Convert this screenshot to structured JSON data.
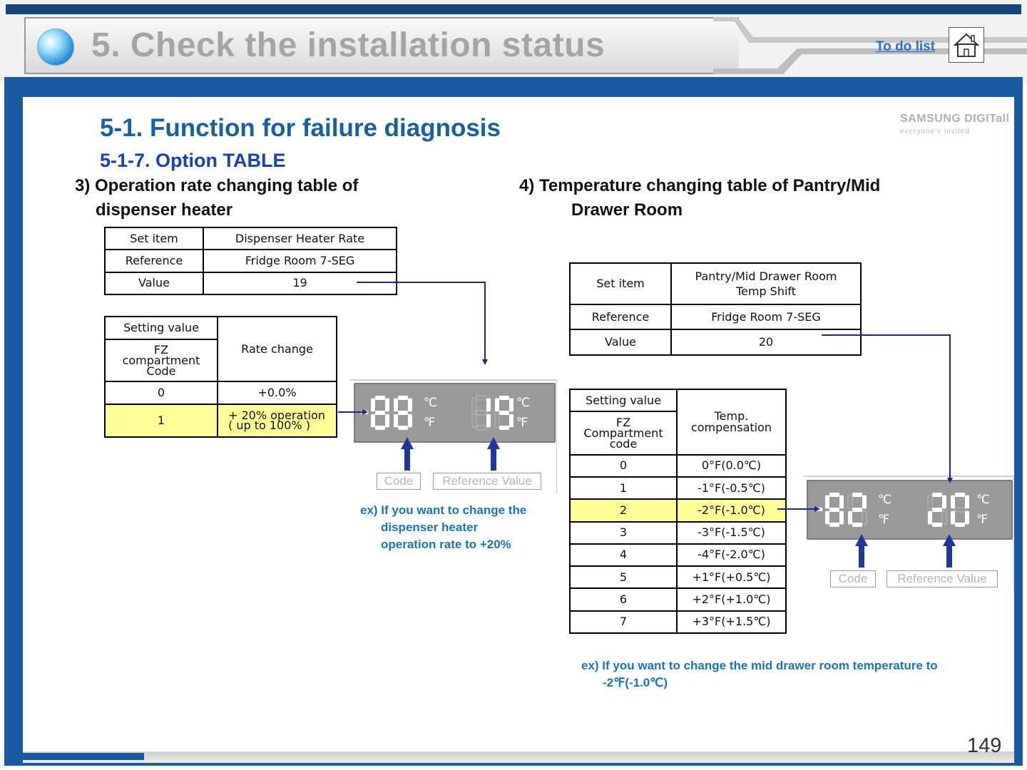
{
  "header": {
    "title": "5. Check the installation status",
    "todo_link": "To do list",
    "home_icon": "home-icon"
  },
  "brand": {
    "logo_text": "SAMSUNG DIGITall",
    "tagline": "everyone's invited"
  },
  "section_title": "5-1. Function for failure diagnosis",
  "sub_title": "5-1-7. Option TABLE",
  "left": {
    "heading_line1": "3) Operation rate changing table of",
    "heading_line2": "dispenser heater",
    "spec_table": {
      "rows": [
        [
          "Set item",
          "Dispenser Heater Rate"
        ],
        [
          "Reference",
          "Fridge Room 7-SEG"
        ],
        [
          "Value",
          "19"
        ]
      ]
    },
    "setting_table": {
      "header_setting": "Setting value",
      "header_code": "FZ compartment Code",
      "header_result": "Rate change",
      "rows": [
        {
          "code": "0",
          "value": "+0.0%"
        },
        {
          "code": "1",
          "value_line1": "+ 20% operation",
          "value_line2": "( up to 100% )"
        }
      ]
    },
    "display": {
      "left_digits": "-88",
      "right_digits": "19",
      "unit_c": "℃",
      "unit_f": "℉",
      "label_code": "Code",
      "label_ref": "Reference Value"
    },
    "example": [
      "ex) If you want to change the",
      "dispenser heater",
      "operation rate to +20%"
    ]
  },
  "right": {
    "heading_line1": "4) Temperature changing table of Pantry/Mid",
    "heading_line2": "Drawer Room",
    "spec_table": {
      "row1_label": "Set item",
      "row1_value_line1": "Pantry/Mid Drawer Room",
      "row1_value_line2": "Temp Shift",
      "row2_label": "Reference",
      "row2_value": "Fridge Room 7-SEG",
      "row3_label": "Value",
      "row3_value": "20"
    },
    "setting_table": {
      "header_setting": "Setting value",
      "header_code_line1": "FZ",
      "header_code_line2": "Compartment",
      "header_code_line3": "code",
      "header_result_line1": "Temp.",
      "header_result_line2": "compensation",
      "rows": [
        [
          "0",
          "0°F(0.0℃)"
        ],
        [
          "1",
          "-1°F(-0.5℃)"
        ],
        [
          "2",
          "-2°F(-1.0℃)"
        ],
        [
          "3",
          "-3°F(-1.5℃)"
        ],
        [
          "4",
          "-4°F(-2.0℃)"
        ],
        [
          "5",
          "+1°F(+0.5℃)"
        ],
        [
          "6",
          "+2°F(+1.0℃)"
        ],
        [
          "7",
          "+3°F(+1.5℃)"
        ]
      ],
      "highlight_row": 2
    },
    "display": {
      "left_digits": "-82",
      "right_digits": "20",
      "unit_c": "℃",
      "unit_f": "℉",
      "label_code": "Code",
      "label_ref": "Reference Value"
    },
    "example": [
      "ex) If you want to change the mid drawer room temperature to",
      "-2℉(-1.0℃)"
    ]
  },
  "page_number": "149",
  "colors": {
    "frame_blue": "#1c5aa3",
    "title_blue": "#1a5fa0",
    "subtitle_blue": "#1a3fbd",
    "example_blue": "#1b73b8",
    "highlight_yellow": "#ffff99",
    "arrow_navy": "#1a2a8c"
  }
}
